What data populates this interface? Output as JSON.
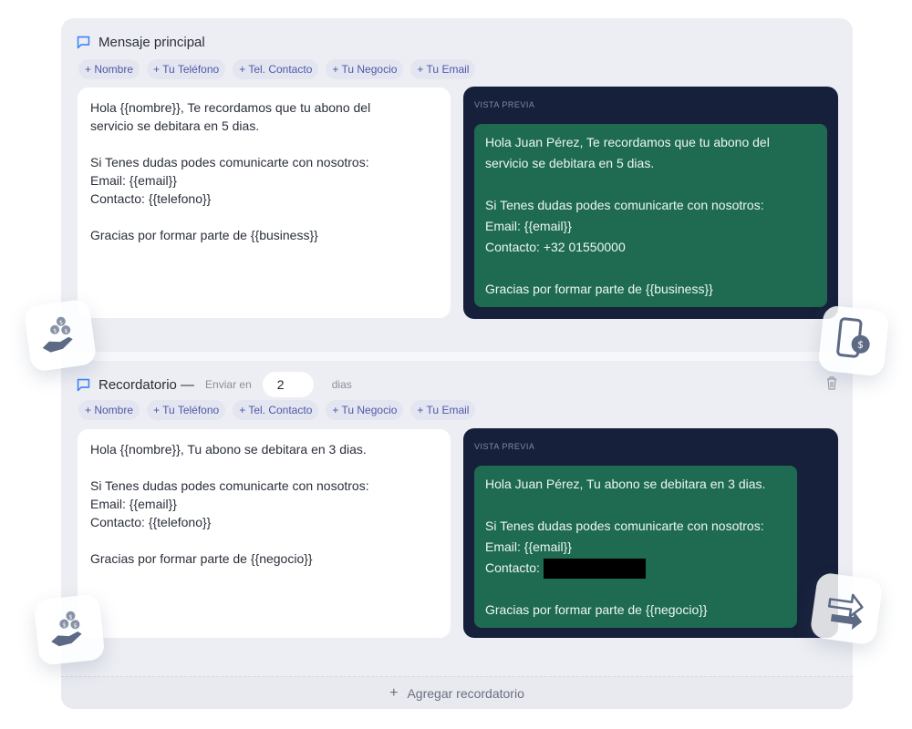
{
  "messages": [
    {
      "title": "Mensaje principal",
      "chips": [
        "+ Nombre",
        "+ Tu Teléfono",
        "+ Tel. Contacto",
        "+ Tu Negocio",
        "+ Tu Email"
      ],
      "editor_text": "Hola {{nombre}}, Te recordamos que tu abono del\nservicio se debitara en 5 dias.\n\nSi Tenes dudas podes comunicarte con nosotros:\nEmail: {{email}}\nContacto: {{telefono}}\n\nGracias por formar parte de {{business}}",
      "preview_label": "VISTA PREVIA",
      "preview_line1": "Hola Juan Pérez, Te recordamos que tu abono del",
      "preview_line2": "servicio se debitara en 5 dias.",
      "preview_line3": "Si Tenes dudas podes comunicarte con nosotros:",
      "preview_line4": "Email: {{email}}",
      "preview_line5": "Contacto: +32 01550000",
      "preview_line6": "Gracias por formar parte de {{business}}"
    },
    {
      "title": "Recordatorio —",
      "send_in_label": "Enviar en",
      "days_value": "2",
      "days_unit": "dias",
      "chips": [
        "+ Nombre",
        "+ Tu Teléfono",
        "+ Tel. Contacto",
        "+ Tu Negocio",
        "+ Tu Email"
      ],
      "editor_text": "Hola {{nombre}}, Tu abono se debitara en 3 dias.\n\nSi Tenes dudas podes comunicarte con nosotros:\nEmail: {{email}}\nContacto: {{telefono}}\n\nGracias por formar parte de {{negocio}}",
      "preview_label": "VISTA PREVIA",
      "preview_line1": "Hola Juan Pérez, Tu abono se debitara en 3 dias.",
      "preview_line2": "Si Tenes dudas podes comunicarte con nosotros:",
      "preview_line3": "Email: {{email}}",
      "preview_line4": "Contacto:",
      "preview_line5": "Gracias por formar parte de {{negocio}}"
    }
  ],
  "add_reminder_label": "Agregar recordatorio",
  "colors": {
    "panel": "#eceef3",
    "chip_text": "#4f58a8",
    "preview_bg": "#17203a",
    "bubble_bg": "#1e6b52"
  },
  "icons": [
    "chat-bubble-icon",
    "trash-icon",
    "plus-icon",
    "money-hand-icon",
    "phone-dollar-icon",
    "arrows-right-icon"
  ]
}
